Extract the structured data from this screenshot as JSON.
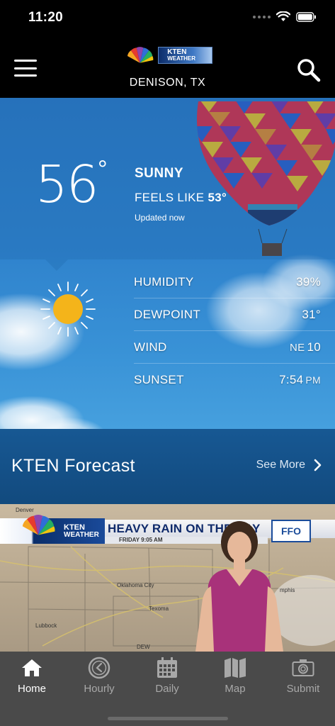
{
  "status_bar": {
    "time": "11:20"
  },
  "header": {
    "logo": {
      "line1": "KTEN",
      "line2": "WEATHER"
    },
    "location": "DENISON, TX"
  },
  "current": {
    "temperature": "56",
    "degree_symbol": "°",
    "condition": "SUNNY",
    "feels_like_label": "FEELS LIKE",
    "feels_like_value": "53°",
    "updated": "Updated now"
  },
  "details": [
    {
      "label": "HUMIDITY",
      "value": "39%",
      "unit_before": "",
      "unit_after": ""
    },
    {
      "label": "DEWPOINT",
      "value": "31°",
      "unit_before": "",
      "unit_after": ""
    },
    {
      "label": "WIND",
      "value": "10",
      "unit_before": "NE",
      "unit_after": ""
    },
    {
      "label": "SUNSET",
      "value": "7:54",
      "unit_before": "",
      "unit_after": "PM"
    }
  ],
  "forecast": {
    "title": "KTEN Forecast",
    "see_more": "See More"
  },
  "video": {
    "logo_line1": "KTEN",
    "logo_line2": "WEATHER",
    "headline": "HEAVY RAIN ON THE DAY",
    "subline": "FRIDAY  9:05 AM",
    "badge": "FFO",
    "map_labels": [
      "Oklahoma City",
      "Texoma",
      "Lubbock",
      "DEW",
      "Denver",
      "mphis"
    ]
  },
  "tabs": [
    {
      "label": "Home",
      "icon": "home-icon",
      "active": true
    },
    {
      "label": "Hourly",
      "icon": "clock-icon",
      "active": false
    },
    {
      "label": "Daily",
      "icon": "calendar-icon",
      "active": false
    },
    {
      "label": "Map",
      "icon": "map-icon",
      "active": false
    },
    {
      "label": "Submit",
      "icon": "camera-icon",
      "active": false
    }
  ],
  "colors": {
    "sky_top": "#2a77c2",
    "forecast_bar": "#175893",
    "tab_bar": "#4a4a4a",
    "sun": "#f4b41a"
  }
}
